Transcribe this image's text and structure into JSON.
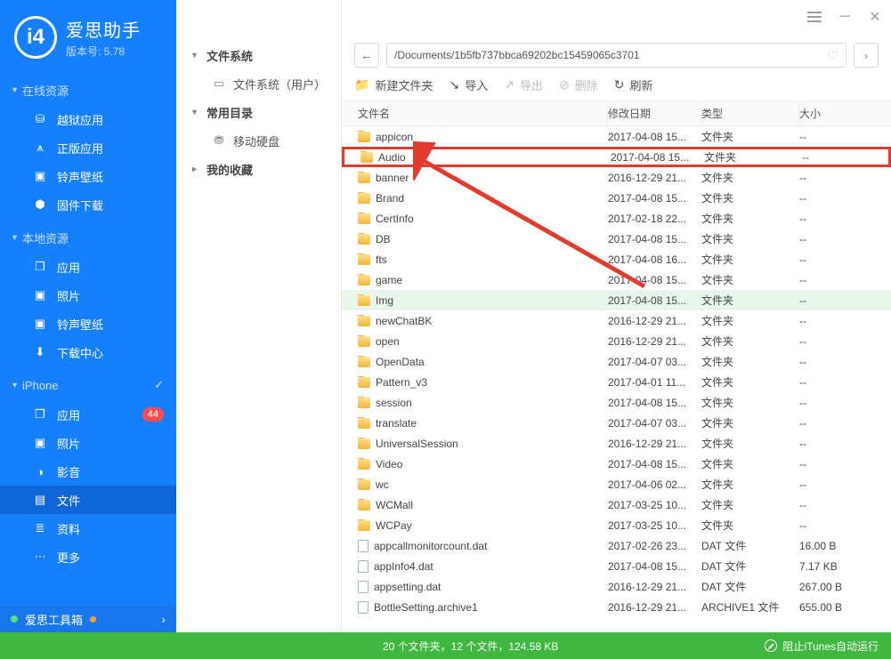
{
  "brand": {
    "title": "爱思助手",
    "version": "版本号: 5.78"
  },
  "sidebar": {
    "sections": [
      {
        "label": "在线资源",
        "items": [
          {
            "icon": "⛁",
            "label": "越狱应用"
          },
          {
            "icon": "⩚",
            "label": "正版应用"
          },
          {
            "icon": "▣",
            "label": "铃声壁纸"
          },
          {
            "icon": "⬢",
            "label": "固件下载"
          }
        ]
      },
      {
        "label": "本地资源",
        "items": [
          {
            "icon": "❒",
            "label": "应用"
          },
          {
            "icon": "▣",
            "label": "照片"
          },
          {
            "icon": "▣",
            "label": "铃声壁纸"
          },
          {
            "icon": "⬇",
            "label": "下载中心"
          }
        ]
      },
      {
        "label": "iPhone",
        "check": true,
        "items": [
          {
            "icon": "❒",
            "label": "应用",
            "badge": "44"
          },
          {
            "icon": "▣",
            "label": "照片"
          },
          {
            "icon": "◑",
            "label": "影音"
          },
          {
            "icon": "▤",
            "label": "文件",
            "active": true
          },
          {
            "icon": "≣",
            "label": "资料"
          },
          {
            "icon": "⋯",
            "label": "更多"
          }
        ]
      }
    ],
    "footer": {
      "label": "爱思工具箱"
    }
  },
  "tree": {
    "root": {
      "label": "文件系统"
    },
    "child0": {
      "label": "文件系统（用户）"
    },
    "group1": {
      "label": "常用目录"
    },
    "child1": {
      "label": "移动硬盘"
    },
    "group2": {
      "label": "我的收藏"
    }
  },
  "path": {
    "value": "/Documents/1b5fb737bbca69202bc15459065c3701"
  },
  "toolbar": {
    "newFolder": "新建文件夹",
    "import_": "导入",
    "export_": "导出",
    "delete_": "删除",
    "refresh": "刷新"
  },
  "table": {
    "headers": {
      "name": "文件名",
      "date": "修改日期",
      "type": "类型",
      "size": "大小"
    },
    "rows": [
      {
        "kind": "folder",
        "name": "appicon",
        "date": "2017-04-08 15...",
        "type": "文件夹",
        "size": "--"
      },
      {
        "kind": "folder",
        "name": "Audio",
        "date": "2017-04-08 15...",
        "type": "文件夹",
        "size": "--",
        "highlight": true
      },
      {
        "kind": "folder",
        "name": "banner",
        "date": "2016-12-29 21...",
        "type": "文件夹",
        "size": "--"
      },
      {
        "kind": "folder",
        "name": "Brand",
        "date": "2017-04-08 15...",
        "type": "文件夹",
        "size": "--"
      },
      {
        "kind": "folder",
        "name": "CertInfo",
        "date": "2017-02-18 22...",
        "type": "文件夹",
        "size": "--"
      },
      {
        "kind": "folder",
        "name": "DB",
        "date": "2017-04-08 15...",
        "type": "文件夹",
        "size": "--"
      },
      {
        "kind": "folder",
        "name": "fts",
        "date": "2017-04-08 16...",
        "type": "文件夹",
        "size": "--"
      },
      {
        "kind": "folder",
        "name": "game",
        "date": "2017-04-08 15...",
        "type": "文件夹",
        "size": "--"
      },
      {
        "kind": "folder",
        "name": "Img",
        "date": "2017-04-08 15...",
        "type": "文件夹",
        "size": "--",
        "hovered": true
      },
      {
        "kind": "folder",
        "name": "newChatBK",
        "date": "2016-12-29 21...",
        "type": "文件夹",
        "size": "--"
      },
      {
        "kind": "folder",
        "name": "open",
        "date": "2016-12-29 21...",
        "type": "文件夹",
        "size": "--"
      },
      {
        "kind": "folder",
        "name": "OpenData",
        "date": "2017-04-07 03...",
        "type": "文件夹",
        "size": "--"
      },
      {
        "kind": "folder",
        "name": "Pattern_v3",
        "date": "2017-04-01 11...",
        "type": "文件夹",
        "size": "--"
      },
      {
        "kind": "folder",
        "name": "session",
        "date": "2017-04-08 15...",
        "type": "文件夹",
        "size": "--"
      },
      {
        "kind": "folder",
        "name": "translate",
        "date": "2017-04-07 03...",
        "type": "文件夹",
        "size": "--"
      },
      {
        "kind": "folder",
        "name": "UniversalSession",
        "date": "2016-12-29 21...",
        "type": "文件夹",
        "size": "--"
      },
      {
        "kind": "folder",
        "name": "Video",
        "date": "2017-04-08 15...",
        "type": "文件夹",
        "size": "--"
      },
      {
        "kind": "folder",
        "name": "wc",
        "date": "2017-04-06 02...",
        "type": "文件夹",
        "size": "--"
      },
      {
        "kind": "folder",
        "name": "WCMall",
        "date": "2017-03-25 10...",
        "type": "文件夹",
        "size": "--"
      },
      {
        "kind": "folder",
        "name": "WCPay",
        "date": "2017-03-25 10...",
        "type": "文件夹",
        "size": "--"
      },
      {
        "kind": "file",
        "name": "appcallmonitorcount.dat",
        "date": "2017-02-26 23...",
        "type": "DAT 文件",
        "size": "16.00 B"
      },
      {
        "kind": "file",
        "name": "appInfo4.dat",
        "date": "2017-04-08 15...",
        "type": "DAT 文件",
        "size": "7.17 KB"
      },
      {
        "kind": "file",
        "name": "appsetting.dat",
        "date": "2016-12-29 21...",
        "type": "DAT 文件",
        "size": "267.00 B"
      },
      {
        "kind": "file",
        "name": "BottleSetting.archive1",
        "date": "2016-12-29 21...",
        "type": "ARCHIVE1 文件",
        "size": "655.00 B"
      }
    ]
  },
  "status": {
    "summary": "20 个文件夹，12 个文件，124.58 KB",
    "itunes": "阻止iTunes自动运行"
  }
}
